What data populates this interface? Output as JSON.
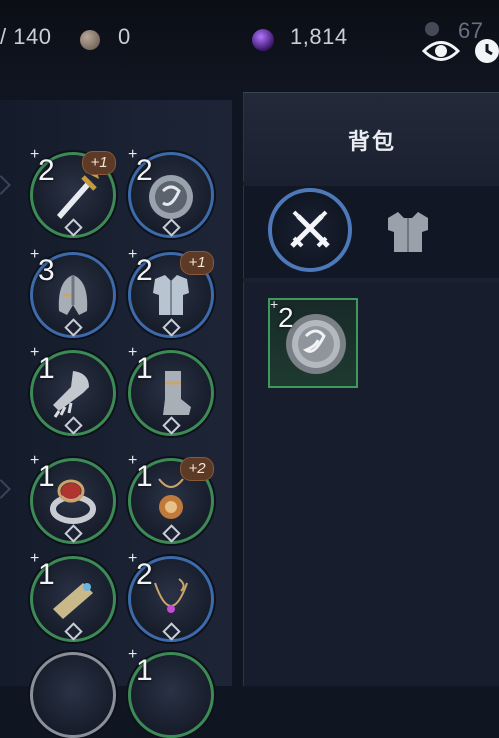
{
  "resources": {
    "capacity": "/ 140",
    "stone": "0",
    "crystal": "1,814",
    "gem_partial": "67"
  },
  "bag": {
    "title": "背包",
    "tab_weapons_icon": "crossed-swords-icon",
    "tab_armor_icon": "chest-armor-icon",
    "items": [
      {
        "name": "shield",
        "plus": "+",
        "qty": "2"
      }
    ]
  },
  "equipment": [
    {
      "key": "sword",
      "plus": "+",
      "level": "2",
      "badge": "+1",
      "ring": "green"
    },
    {
      "key": "shield",
      "plus": "+",
      "level": "2",
      "badge": "",
      "ring": "blue"
    },
    {
      "key": "helmet",
      "plus": "+",
      "level": "3",
      "badge": "",
      "ring": "blue"
    },
    {
      "key": "armor",
      "plus": "+",
      "level": "2",
      "badge": "+1",
      "ring": "blue"
    },
    {
      "key": "gauntlet",
      "plus": "+",
      "level": "1",
      "badge": "",
      "ring": "green"
    },
    {
      "key": "boots",
      "plus": "+",
      "level": "1",
      "badge": "",
      "ring": "green"
    },
    {
      "key": "ring",
      "plus": "+",
      "level": "1",
      "badge": "",
      "ring": "green"
    },
    {
      "key": "amulet",
      "plus": "+",
      "level": "1",
      "badge": "+2",
      "ring": "green"
    },
    {
      "key": "bracer",
      "plus": "+",
      "level": "1",
      "badge": "",
      "ring": "green"
    },
    {
      "key": "necklace",
      "plus": "+",
      "level": "2",
      "badge": "",
      "ring": "blue"
    },
    {
      "key": "partial-a",
      "plus": "",
      "level": "",
      "badge": "",
      "ring": "grey"
    },
    {
      "key": "partial-b",
      "plus": "+",
      "level": "1",
      "badge": "",
      "ring": "green"
    }
  ]
}
